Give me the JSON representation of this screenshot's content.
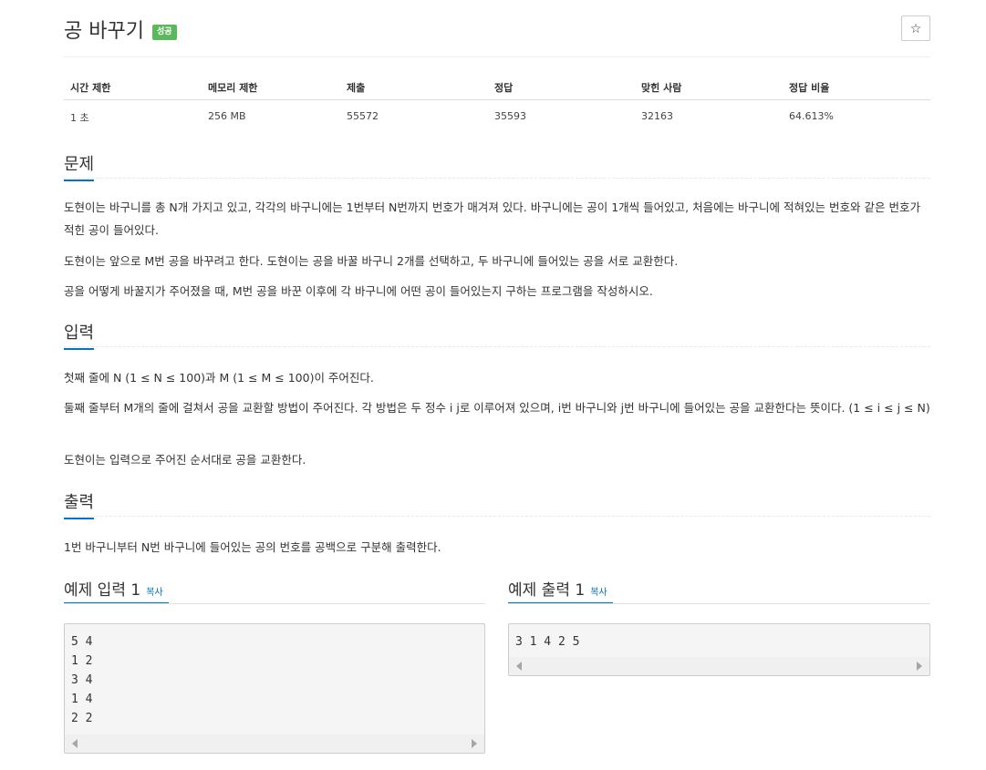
{
  "problem": {
    "title": "공 바꾸기",
    "badge": "성공",
    "star_icon": "☆"
  },
  "info_table": {
    "headers": [
      "시간 제한",
      "메모리 제한",
      "제출",
      "정답",
      "맞힌 사람",
      "정답 비율"
    ],
    "values": [
      "1 초",
      "256 MB",
      "55572",
      "35593",
      "32163",
      "64.613%"
    ]
  },
  "sections": {
    "problem": {
      "title": "문제",
      "paragraphs": [
        "도현이는 바구니를 총 N개 가지고 있고, 각각의 바구니에는 1번부터 N번까지 번호가 매겨져 있다. 바구니에는 공이 1개씩 들어있고, 처음에는 바구니에 적혀있는 번호와 같은 번호가 적힌 공이 들어있다.",
        "도현이는 앞으로 M번 공을 바꾸려고 한다. 도현이는 공을 바꿀 바구니 2개를 선택하고, 두 바구니에 들어있는 공을 서로 교환한다.",
        "공을 어떻게 바꿀지가 주어졌을 때, M번 공을 바꾼 이후에 각 바구니에 어떤 공이 들어있는지 구하는 프로그램을 작성하시오."
      ]
    },
    "input": {
      "title": "입력",
      "paragraphs": [
        "첫째 줄에 N (1 ≤ N ≤ 100)과 M (1 ≤ M ≤ 100)이 주어진다.",
        "둘째 줄부터 M개의 줄에 걸쳐서 공을 교환할 방법이 주어진다. 각 방법은 두 정수 i j로 이루어져 있으며, i번 바구니와 j번 바구니에 들어있는 공을 교환한다는 뜻이다. (1 ≤ i ≤ j ≤ N)",
        "도현이는 입력으로 주어진 순서대로 공을 교환한다."
      ]
    },
    "output": {
      "title": "출력",
      "paragraphs": [
        "1번 바구니부터 N번 바구니에 들어있는 공의 번호를 공백으로 구분해 출력한다."
      ]
    }
  },
  "samples": {
    "input": {
      "title": "예제 입력 1",
      "copy": "복사",
      "content": "5 4\n1 2\n3 4\n1 4\n2 2"
    },
    "output": {
      "title": "예제 출력 1",
      "copy": "복사",
      "content": "3 1 4 2 5"
    }
  }
}
